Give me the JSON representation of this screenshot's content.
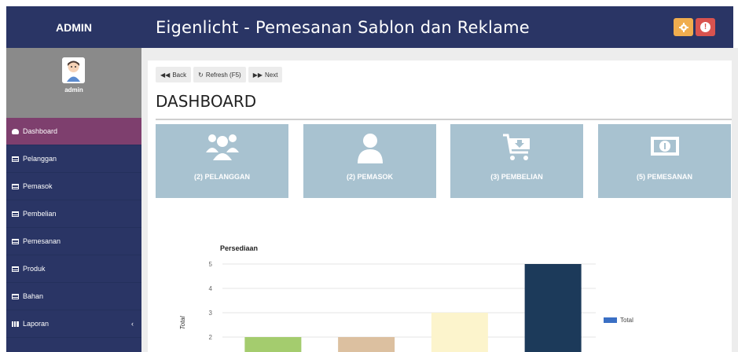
{
  "header": {
    "brand": "ADMIN",
    "title": "Eigenlicht - Pemesanan Sablon dan Reklame",
    "gear_color": "#f0ad4e",
    "alert_color": "#d9534f"
  },
  "profile": {
    "name": "admin"
  },
  "sidebar": {
    "items": [
      {
        "label": "Dashboard",
        "icon": "dashboard-icon",
        "active": true
      },
      {
        "label": "Pelanggan",
        "icon": "table-icon"
      },
      {
        "label": "Pemasok",
        "icon": "table-icon"
      },
      {
        "label": "Pembelian",
        "icon": "table-icon"
      },
      {
        "label": "Pemesanan",
        "icon": "table-icon"
      },
      {
        "label": "Produk",
        "icon": "table-icon"
      },
      {
        "label": "Bahan",
        "icon": "table-icon"
      },
      {
        "label": "Laporan",
        "icon": "bar-chart-icon",
        "caret": "‹"
      }
    ]
  },
  "toolbar": {
    "back_label": "Back",
    "refresh_label": "Refresh (F5)",
    "next_label": "Next"
  },
  "page": {
    "title": "DASHBOARD"
  },
  "tiles": [
    {
      "label": "(2) PELANGGAN",
      "icon": "users-icon"
    },
    {
      "label": "(2) PEMASOK",
      "icon": "user-icon"
    },
    {
      "label": "(3) PEMBELIAN",
      "icon": "cart-icon"
    },
    {
      "label": "(5) PEMESANAN",
      "icon": "money-icon"
    }
  ],
  "chart_data": {
    "type": "bar",
    "title": "Persediaan",
    "ylabel": "Total",
    "xlabel": "",
    "ylim": [
      0,
      5
    ],
    "yticks": [
      1,
      2,
      3,
      4,
      5
    ],
    "grid": true,
    "legend": {
      "position": "right",
      "entries": [
        {
          "name": "Total",
          "color": "#3a6fc4"
        }
      ]
    },
    "values": [
      2,
      2,
      3,
      5
    ],
    "bar_colors": [
      "#a4cc6e",
      "#dcc0a0",
      "#fcf4cc",
      "#1c3a5a"
    ]
  }
}
